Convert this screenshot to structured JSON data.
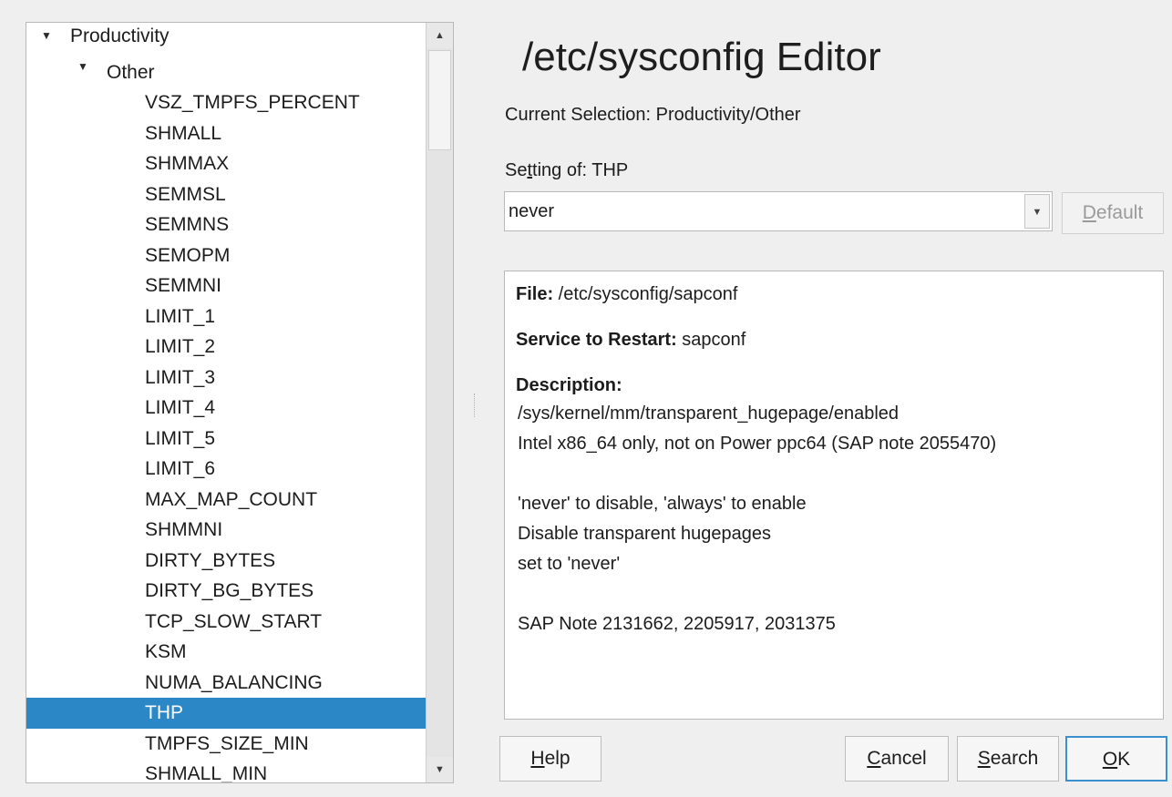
{
  "tree": {
    "items": [
      {
        "label": "Productivity",
        "level": 0,
        "expanded": true
      },
      {
        "label": "Other",
        "level": 1,
        "expanded": true
      },
      {
        "label": "VSZ_TMPFS_PERCENT",
        "level": 2
      },
      {
        "label": "SHMALL",
        "level": 2
      },
      {
        "label": "SHMMAX",
        "level": 2
      },
      {
        "label": "SEMMSL",
        "level": 2
      },
      {
        "label": "SEMMNS",
        "level": 2
      },
      {
        "label": "SEMOPM",
        "level": 2
      },
      {
        "label": "SEMMNI",
        "level": 2
      },
      {
        "label": "LIMIT_1",
        "level": 2
      },
      {
        "label": "LIMIT_2",
        "level": 2
      },
      {
        "label": "LIMIT_3",
        "level": 2
      },
      {
        "label": "LIMIT_4",
        "level": 2
      },
      {
        "label": "LIMIT_5",
        "level": 2
      },
      {
        "label": "LIMIT_6",
        "level": 2
      },
      {
        "label": "MAX_MAP_COUNT",
        "level": 2
      },
      {
        "label": "SHMMNI",
        "level": 2
      },
      {
        "label": "DIRTY_BYTES",
        "level": 2
      },
      {
        "label": "DIRTY_BG_BYTES",
        "level": 2
      },
      {
        "label": "TCP_SLOW_START",
        "level": 2
      },
      {
        "label": "KSM",
        "level": 2
      },
      {
        "label": "NUMA_BALANCING",
        "level": 2
      },
      {
        "label": "THP",
        "level": 2,
        "selected": true
      },
      {
        "label": "TMPFS_SIZE_MIN",
        "level": 2
      },
      {
        "label": "SHMALL_MIN",
        "level": 2
      }
    ],
    "selected_color": "#2c87c6"
  },
  "header": {
    "title": "/etc/sysconfig Editor"
  },
  "selection": {
    "current": "Current Selection: Productivity/Other"
  },
  "setting": {
    "label_pre": "Se",
    "label_mnemonic": "t",
    "label_post": "ting of: THP",
    "value": "never",
    "default_pre": "",
    "default_mnemonic": "D",
    "default_post": "efault"
  },
  "info": {
    "file_label": "File:",
    "file_value": " /etc/sysconfig/sapconf",
    "service_label": "Service to Restart:",
    "service_value": " sapconf",
    "description_label": "Description:",
    "description_lines": [
      "/sys/kernel/mm/transparent_hugepage/enabled",
      "Intel x86_64 only, not on Power ppc64 (SAP note 2055470)",
      "",
      "'never' to disable, 'always' to enable",
      "Disable transparent hugepages",
      "set to 'never'",
      "",
      "SAP Note 2131662, 2205917, 2031375"
    ]
  },
  "buttons": {
    "help_mnemonic": "H",
    "help_rest": "elp",
    "cancel_mnemonic": "C",
    "cancel_rest": "ancel",
    "search_mnemonic": "S",
    "search_rest": "earch",
    "ok_mnemonic": "O",
    "ok_rest": "K"
  },
  "icons": {
    "expand": "triangle-down-icon",
    "scroll_up": "scroll-up-arrow-icon",
    "scroll_down": "scroll-down-arrow-icon",
    "combo_dropdown": "chevron-down-icon"
  }
}
